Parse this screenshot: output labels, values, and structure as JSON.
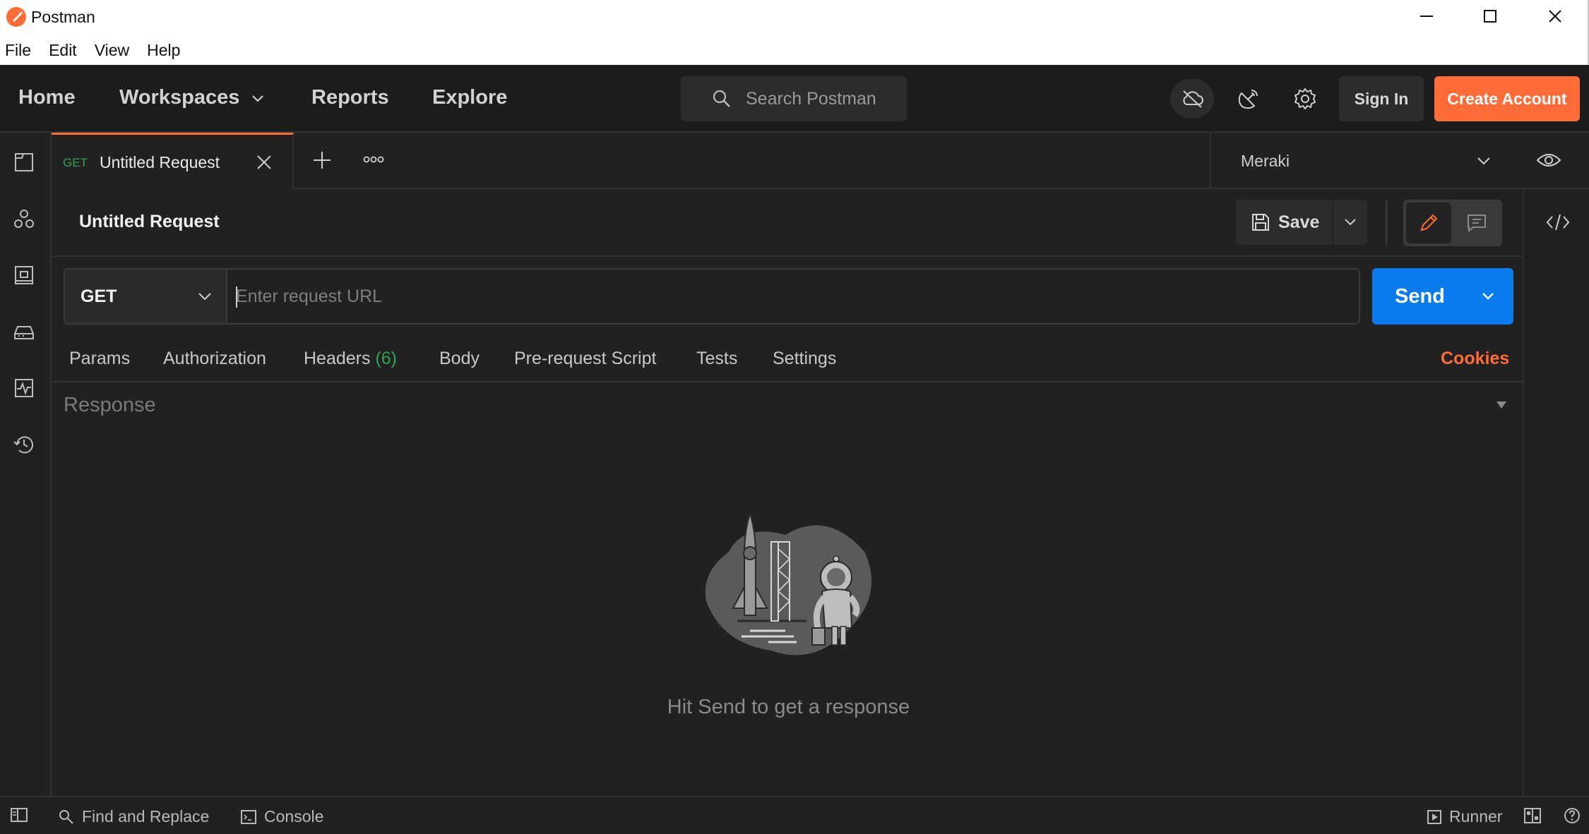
{
  "window": {
    "title": "Postman",
    "menu": [
      "File",
      "Edit",
      "View",
      "Help"
    ]
  },
  "header": {
    "nav": {
      "home": "Home",
      "workspaces": "Workspaces",
      "reports": "Reports",
      "explore": "Explore"
    },
    "search_placeholder": "Search Postman",
    "sign_in": "Sign In",
    "create_account": "Create Account"
  },
  "tabs": {
    "active": {
      "method": "GET",
      "title": "Untitled Request"
    }
  },
  "environment": {
    "selected": "Meraki"
  },
  "request": {
    "title": "Untitled Request",
    "save_label": "Save",
    "method": "GET",
    "url_value": "",
    "url_placeholder": "Enter request URL",
    "send_label": "Send",
    "tabs": {
      "params": "Params",
      "authorization": "Authorization",
      "headers": "Headers",
      "headers_count": "(6)",
      "body": "Body",
      "prerequest": "Pre-request Script",
      "tests": "Tests",
      "settings": "Settings"
    },
    "cookies": "Cookies"
  },
  "response": {
    "label": "Response",
    "empty_message": "Hit Send to get a response"
  },
  "statusbar": {
    "find_replace": "Find and Replace",
    "console": "Console",
    "runner": "Runner"
  },
  "colors": {
    "accent": "#ff6c37",
    "send": "#097bed",
    "get_method": "#2ea44f",
    "background": "#212121"
  },
  "icons": {
    "sidebar": [
      "collections-icon",
      "apis-icon",
      "environments-icon",
      "mock-servers-icon",
      "monitors-icon",
      "history-icon"
    ],
    "header": [
      "sync-cloud-icon",
      "satellite-icon",
      "settings-gear-icon"
    ]
  }
}
